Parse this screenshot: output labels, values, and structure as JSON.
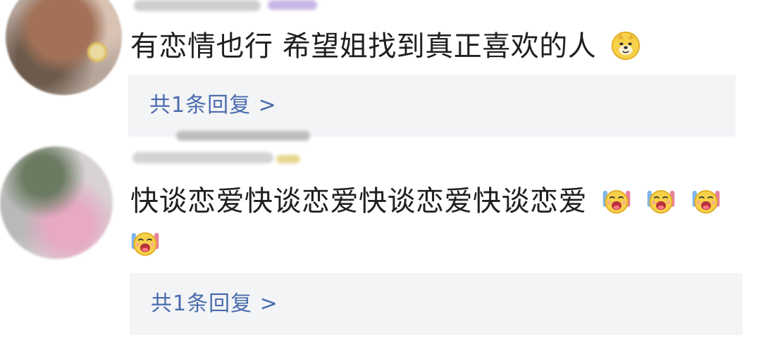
{
  "comments": [
    {
      "text": "有恋情也行 希望姐找到真正喜欢的人",
      "emojis": [
        "dog-emoji"
      ],
      "reply_label": "共1条回复 >"
    },
    {
      "text": "快谈恋爱快谈恋爱快谈恋爱快谈恋爱",
      "emojis": [
        "cheer-emoji",
        "cheer-emoji",
        "cheer-emoji",
        "cheer-emoji"
      ],
      "reply_label": "共1条回复 >"
    }
  ],
  "colors": {
    "reply_link": "#4a6cae",
    "reply_background": "#f3f4f6",
    "comment_text": "#1f1f1f"
  }
}
